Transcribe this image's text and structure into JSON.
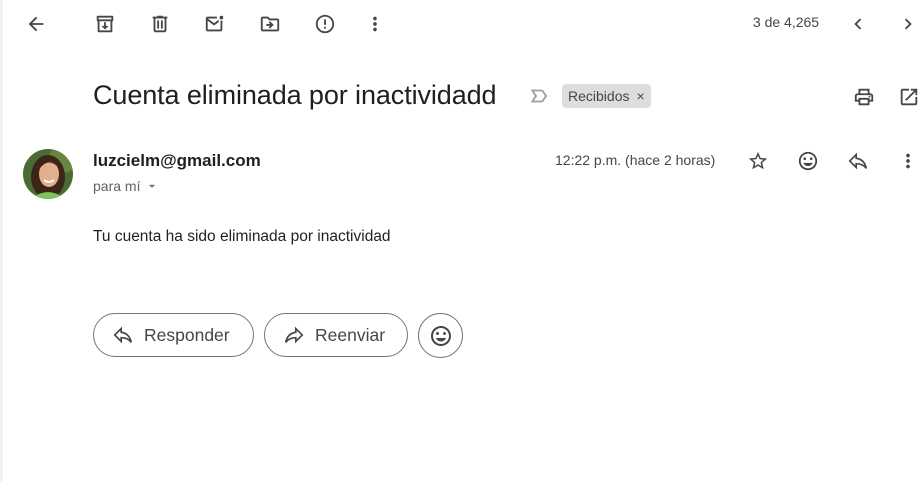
{
  "toolbar": {
    "back_icon": "arrow-back-icon",
    "archive_icon": "archive-icon",
    "delete_icon": "trash-icon",
    "mark_unread_icon": "mark-unread-icon",
    "move_icon": "move-to-folder-icon",
    "spam_icon": "report-spam-icon",
    "more_icon": "more-vert-icon",
    "counter": "3 de 4,265",
    "prev_icon": "chevron-left-icon",
    "next_icon": "chevron-right-icon"
  },
  "email": {
    "subject": "Cuenta eliminada por inactividadd",
    "importance_icon": "label-importance-outline-icon",
    "label": "Recibidos",
    "label_close": "×",
    "print_icon": "print-icon",
    "open_new_window_icon": "open-in-new-icon",
    "sender": "luzcielm@gmail.com",
    "recipient": "para mí",
    "time": "12:22 p.m. (hace 2 horas)",
    "body": "Tu cuenta ha sido eliminada por inactividad"
  },
  "actions": {
    "reply_label": "Responder",
    "forward_label": "Reenviar"
  },
  "colors": {
    "icon": "#444746",
    "chip_bg": "#dddddd",
    "pill_border": "#747775",
    "avatar_bg": "#3a5a2a"
  }
}
